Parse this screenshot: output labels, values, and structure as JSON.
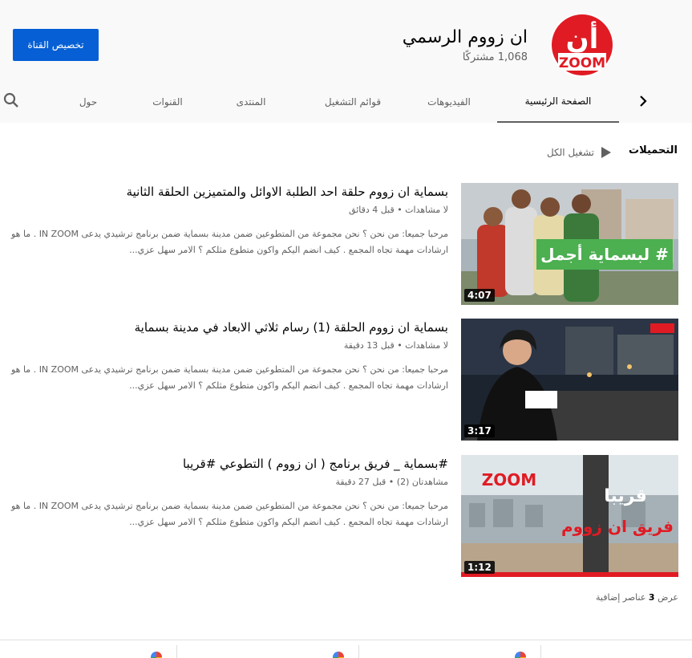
{
  "header": {
    "customize_label": "تخصيص القناة",
    "channel_name": "ان زووم الرسمي",
    "subscribers": "1,068 مشتركًا",
    "logo_text_top": "أن",
    "logo_text_bottom": "ZOOM",
    "brand_color": "#e01b24"
  },
  "tabs": {
    "home": "الصفحة الرئيسية",
    "videos": "الفيديوهات",
    "playlists": "قوائم التشغيل",
    "community": "المنتدى",
    "channels": "القنوات",
    "about": "حول"
  },
  "section": {
    "title": "التحميلات",
    "play_all": "تشغيل الكل"
  },
  "videos": [
    {
      "title": "بسماية ان زووم حلقة احد الطلبة الاوائل والمتميزين الحلقة الثانية",
      "meta": "لا مشاهدات • قبل 4 دقائق",
      "desc_line1": "مرحبا جميعا: من نحن ؟ نحن مجموعة من المتطوعين ضمن مدينة بسماية ضمن برنامج ترشيدي يدعى IN ZOOM . ما هو",
      "desc_line2": "ارشادات مهمة تجاه المجمع . كيف انضم اليكم واكون متطوع مثلكم ؟ الامر سهل عزي...",
      "duration": "4:07",
      "overlay": "# لبسماية أجمل"
    },
    {
      "title": "بسماية ان زووم الحلقة (1) رسام ثلاثي الابعاد في مدينة بسماية",
      "meta": "لا مشاهدات • قبل 13 دقيقة",
      "desc_line1": "مرحبا جميعا: من نحن ؟ نحن مجموعة من المتطوعين ضمن مدينة بسماية ضمن برنامج ترشيدي يدعى IN ZOOM . ما هو",
      "desc_line2": "ارشادات مهمة تجاه المجمع . كيف انضم اليكم واكون متطوع مثلكم ؟ الامر سهل عزي...",
      "duration": "3:17",
      "overlay": ""
    },
    {
      "title": "#بسماية _ فريق برنامج ( ان زووم ) التطوعي #قريبا",
      "meta": "مشاهدتان (2) • قبل 27 دقيقة",
      "desc_line1": "مرحبا جميعا: من نحن ؟ نحن مجموعة من المتطوعين ضمن مدينة بسماية ضمن برنامج ترشيدي يدعى IN ZOOM . ما هو",
      "desc_line2": "ارشادات مهمة تجاه المجمع . كيف انضم اليكم واكون متطوع مثلكم ؟ الامر سهل عزي...",
      "duration": "1:12",
      "overlay_top": "قريبا",
      "overlay_bottom": "فريق ان زووم"
    }
  ],
  "more_items": {
    "prefix": "عرض",
    "count": "3",
    "suffix": "عناصر إضافية"
  }
}
